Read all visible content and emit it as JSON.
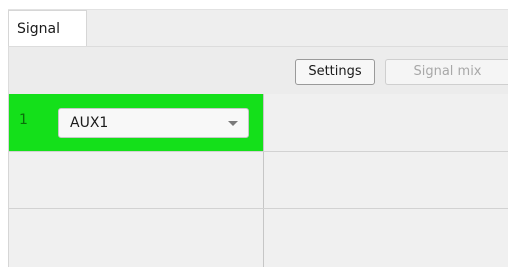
{
  "tabs": [
    {
      "label": "Signal",
      "active": true
    }
  ],
  "toolbar": {
    "settings_label": "Settings",
    "signal_mix_label": "Signal mix"
  },
  "channels": [
    {
      "number": "1",
      "source": "AUX1",
      "color": "#14e01a"
    }
  ]
}
